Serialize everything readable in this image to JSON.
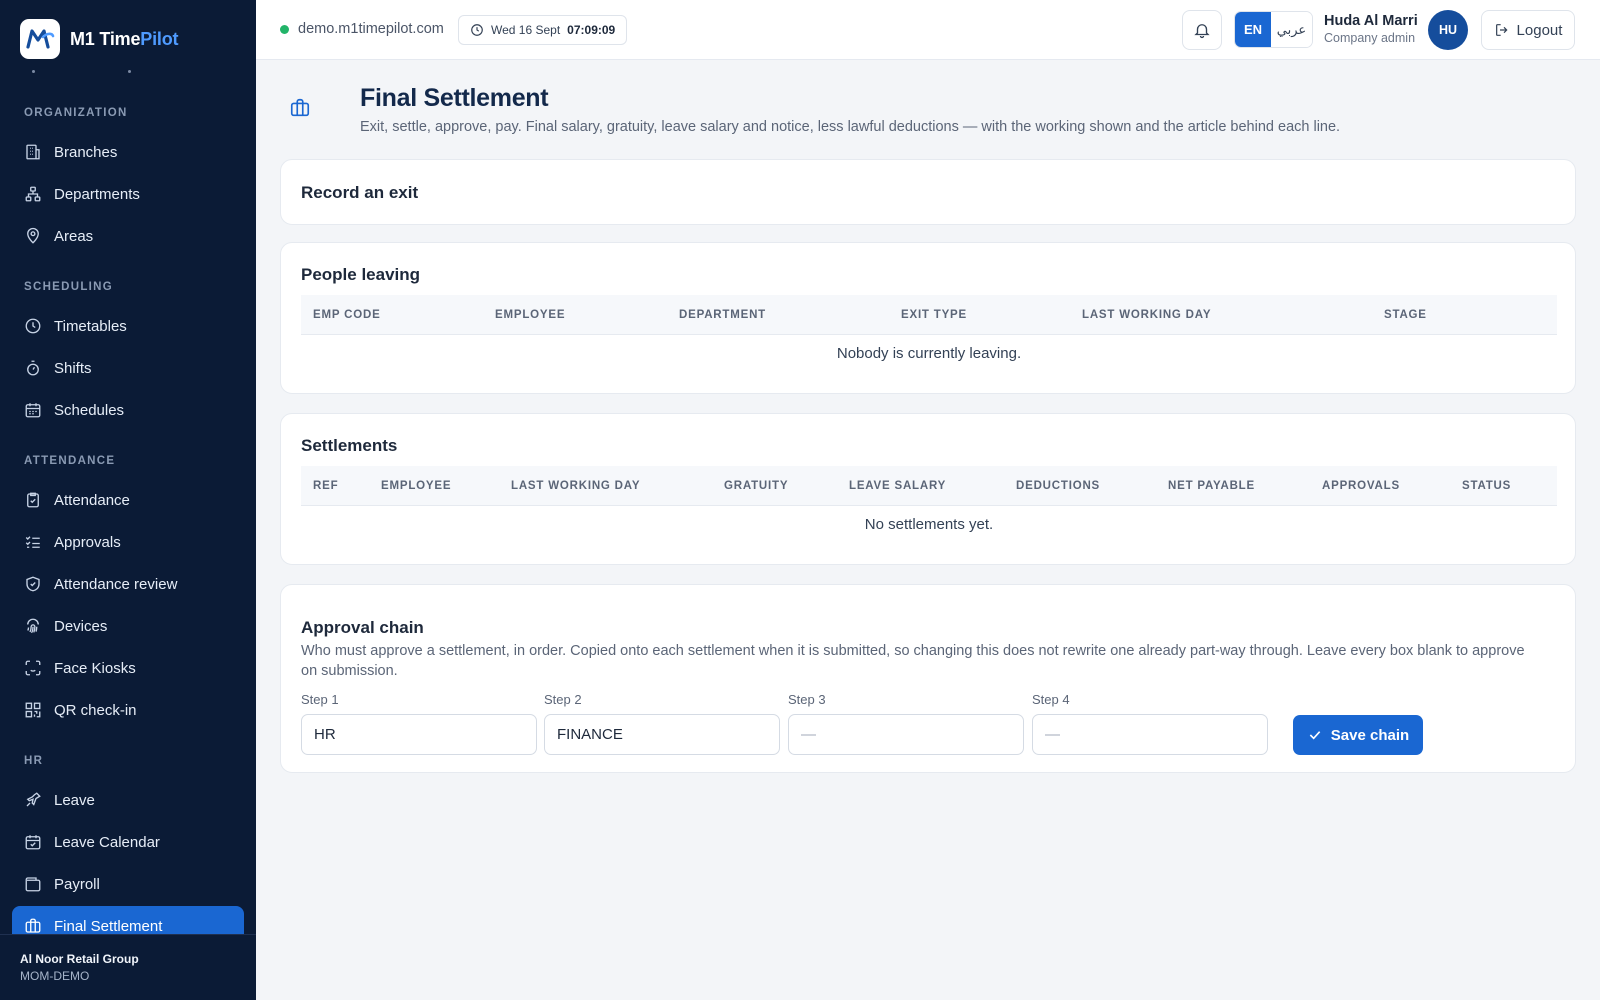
{
  "brand": {
    "logo_text": "M",
    "name_part1": "M1 Time",
    "name_part2": "Pilot"
  },
  "sidebar": {
    "sections": [
      {
        "title": "ORGANIZATION",
        "items": [
          {
            "label": "Branches",
            "icon": "building-icon"
          },
          {
            "label": "Departments",
            "icon": "org-chart-icon"
          },
          {
            "label": "Areas",
            "icon": "map-pin-icon"
          }
        ]
      },
      {
        "title": "SCHEDULING",
        "items": [
          {
            "label": "Timetables",
            "icon": "clock-icon"
          },
          {
            "label": "Shifts",
            "icon": "stopwatch-icon"
          },
          {
            "label": "Schedules",
            "icon": "calendar-icon"
          }
        ]
      },
      {
        "title": "ATTENDANCE",
        "items": [
          {
            "label": "Attendance",
            "icon": "clipboard-check-icon"
          },
          {
            "label": "Approvals",
            "icon": "list-check-icon"
          },
          {
            "label": "Attendance review",
            "icon": "shield-check-icon"
          },
          {
            "label": "Devices",
            "icon": "fingerprint-icon"
          },
          {
            "label": "Face Kiosks",
            "icon": "face-scan-icon"
          },
          {
            "label": "QR check-in",
            "icon": "qr-code-icon"
          }
        ]
      },
      {
        "title": "HR",
        "items": [
          {
            "label": "Leave",
            "icon": "plane-icon"
          },
          {
            "label": "Leave Calendar",
            "icon": "calendar-check-icon"
          },
          {
            "label": "Payroll",
            "icon": "wallet-icon"
          },
          {
            "label": "Final Settlement",
            "icon": "briefcase-icon",
            "active": true
          }
        ]
      }
    ],
    "footer": {
      "org_name": "Al Noor Retail Group",
      "org_code": "MOM-DEMO"
    }
  },
  "topbar": {
    "domain": "demo.m1timepilot.com",
    "date": "Wed 16 Sept",
    "time": "07:09:09",
    "lang_en": "EN",
    "lang_ar": "عربي",
    "user_name": "Huda Al Marri",
    "user_role": "Company admin",
    "avatar_initials": "HU",
    "logout_label": "Logout"
  },
  "page": {
    "title": "Final Settlement",
    "subtitle": "Exit, settle, approve, pay. Final salary, gratuity, leave salary and notice, less lawful deductions — with the working shown and the article behind each line."
  },
  "record_exit": {
    "title": "Record an exit"
  },
  "people_leaving": {
    "title": "People leaving",
    "columns": [
      "EMP CODE",
      "EMPLOYEE",
      "DEPARTMENT",
      "EXIT TYPE",
      "LAST WORKING DAY",
      "STAGE"
    ],
    "empty_text": "Nobody is currently leaving."
  },
  "settlements": {
    "title": "Settlements",
    "columns": [
      "REF",
      "EMPLOYEE",
      "LAST WORKING DAY",
      "GRATUITY",
      "LEAVE SALARY",
      "DEDUCTIONS",
      "NET PAYABLE",
      "APPROVALS",
      "STATUS"
    ],
    "empty_text": "No settlements yet."
  },
  "approval_chain": {
    "title": "Approval chain",
    "description": "Who must approve a settlement, in order. Copied onto each settlement when it is submitted, so changing this does not rewrite one already part-way through. Leave every box blank to approve on submission.",
    "steps": [
      {
        "label": "Step 1",
        "value": "HR",
        "placeholder": "—"
      },
      {
        "label": "Step 2",
        "value": "FINANCE",
        "placeholder": "—"
      },
      {
        "label": "Step 3",
        "value": "",
        "placeholder": "—"
      },
      {
        "label": "Step 4",
        "value": "",
        "placeholder": "—"
      }
    ],
    "save_label": "Save chain"
  }
}
